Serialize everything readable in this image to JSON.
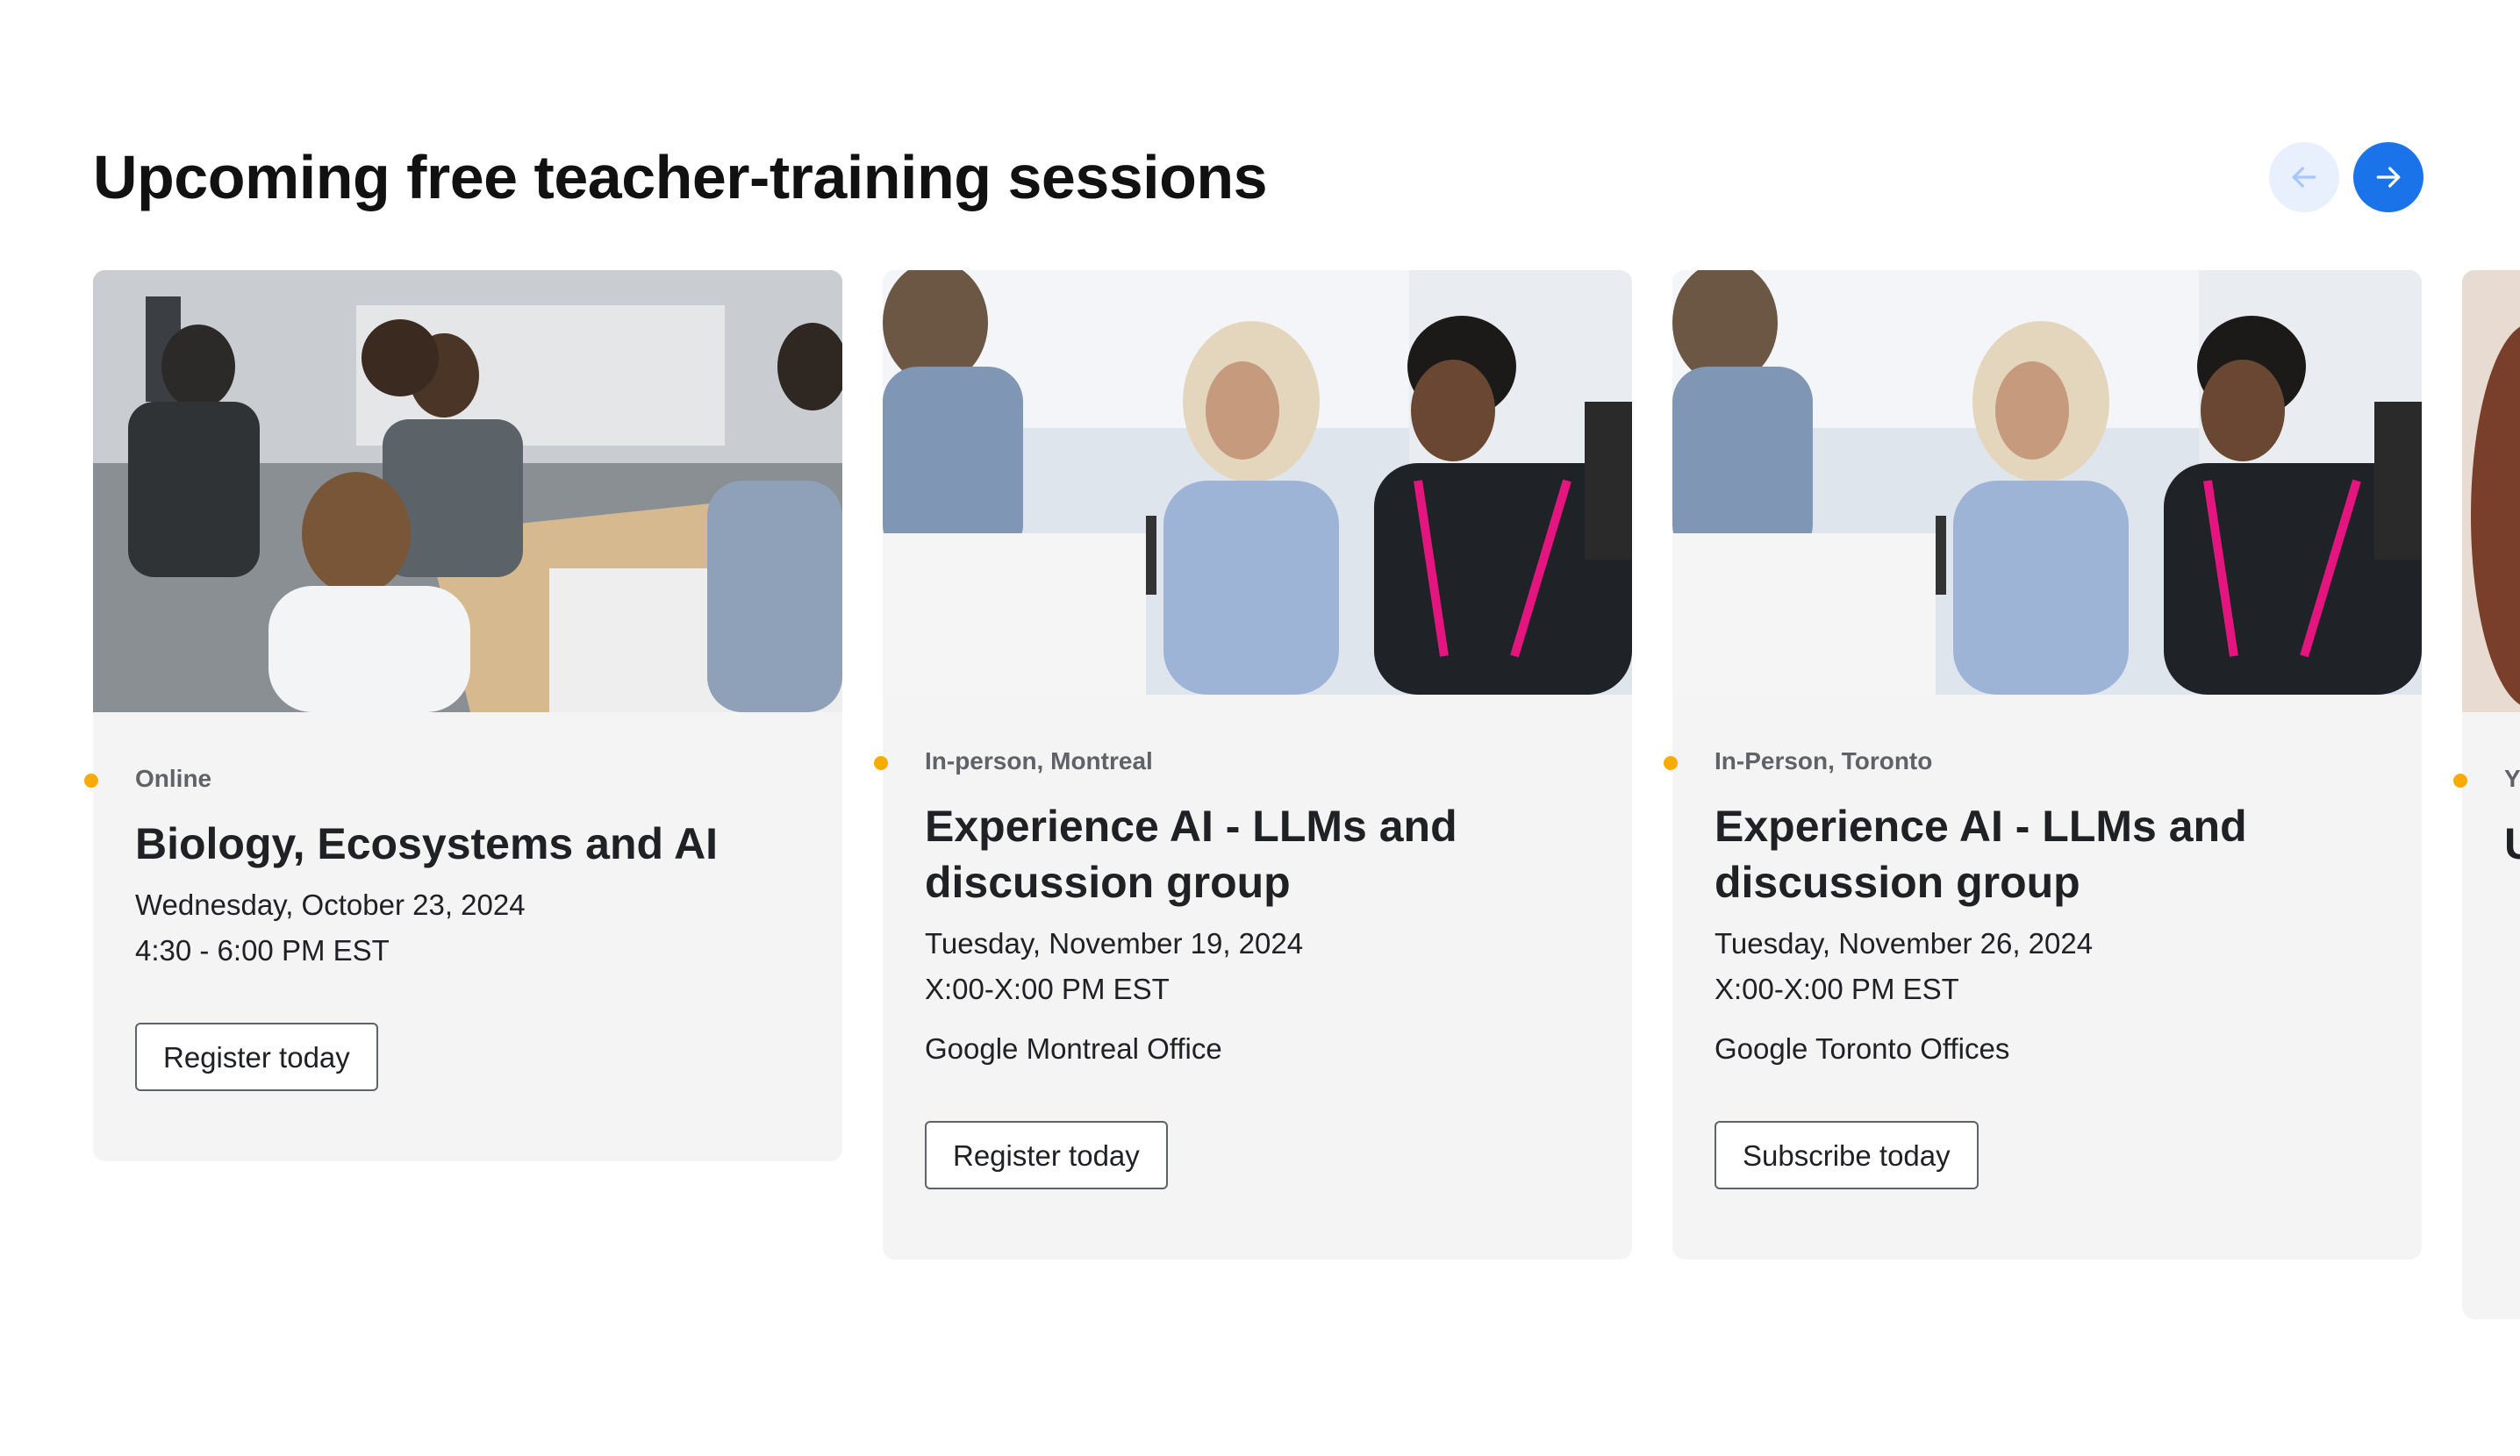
{
  "section": {
    "title": "Upcoming free teacher-training sessions",
    "prev_icon": "arrow-left-icon",
    "next_icon": "arrow-right-icon"
  },
  "colors": {
    "accent_blue": "#1a73e8",
    "prev_button_bg": "#e8f0fe",
    "status_dot": "#f9ab00",
    "card_bg": "#f4f4f4"
  },
  "cards": [
    {
      "location": "Online",
      "title": "Biology, Ecosystems and AI",
      "date": "Wednesday, October 23, 2024",
      "time": "4:30 - 6:00 PM EST",
      "venue": "",
      "cta": "Register today"
    },
    {
      "location": "In-person, Montreal",
      "title": "Experience AI - LLMs and discussion group",
      "date": "Tuesday, November 19, 2024",
      "time": "X:00-X:00 PM EST",
      "venue": "Google Montreal Office",
      "cta": "Register today"
    },
    {
      "location": "In-Person, Toronto",
      "title": "Experience AI - LLMs and discussion group",
      "date": "Tuesday, November 26, 2024",
      "time": "X:00-X:00 PM EST",
      "venue": "Google Toronto Offices",
      "cta": "Subscribe today"
    },
    {
      "location": "Y",
      "title": "U",
      "date": "",
      "time": "",
      "venue": "",
      "cta": ""
    }
  ]
}
